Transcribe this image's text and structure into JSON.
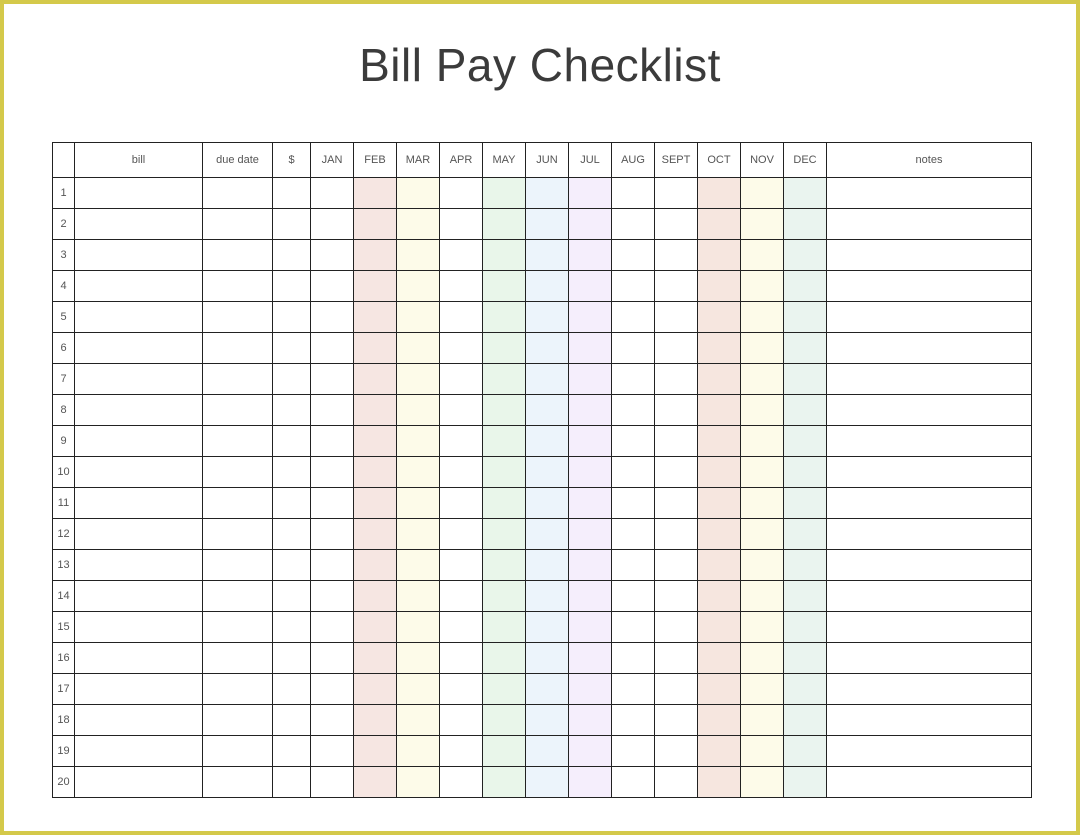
{
  "title": "Bill Pay Checklist",
  "headers": {
    "index": "",
    "bill": "bill",
    "due_date": "due date",
    "amount": "$",
    "months": [
      "JAN",
      "FEB",
      "MAR",
      "APR",
      "MAY",
      "JUN",
      "JUL",
      "AUG",
      "SEPT",
      "OCT",
      "NOV",
      "DEC"
    ],
    "notes": "notes"
  },
  "row_labels": [
    "1",
    "2",
    "3",
    "4",
    "5",
    "6",
    "7",
    "8",
    "9",
    "10",
    "11",
    "12",
    "13",
    "14",
    "15",
    "16",
    "17",
    "18",
    "19",
    "20"
  ],
  "tints": {
    "FEB": "tint-feb",
    "MAR": "tint-mar",
    "MAY": "tint-may",
    "JUN": "tint-jun",
    "JUL": "tint-jul",
    "OCT": "tint-oct",
    "NOV": "tint-nov",
    "DEC": "tint-dec"
  }
}
